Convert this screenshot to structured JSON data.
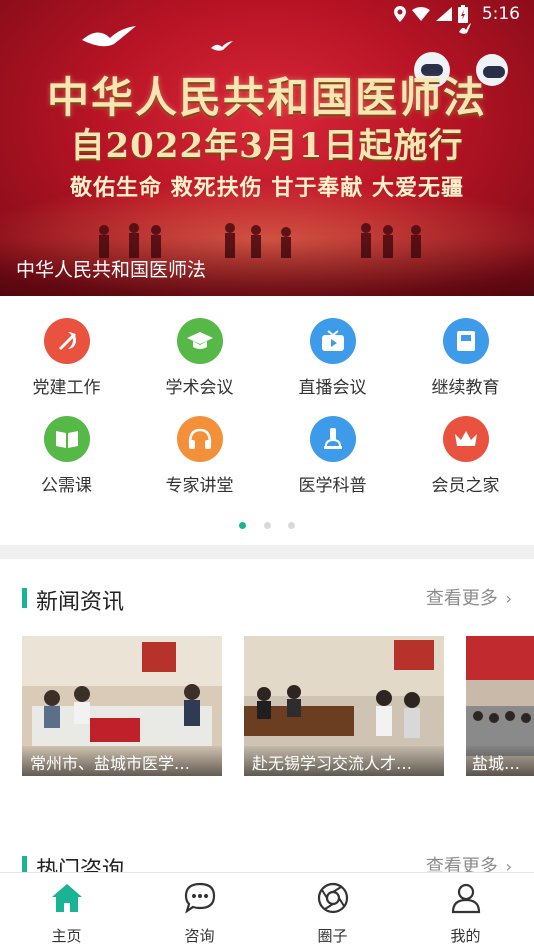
{
  "status_bar": {
    "time": "5:16"
  },
  "banner": {
    "title": "中华人民共和国医师法",
    "subtitle": "自2022年3月1日起施行",
    "slogan": "敬佑生命 救死扶伤 甘于奉献 大爱无疆",
    "caption": "中华人民共和国医师法"
  },
  "grid": {
    "items": [
      {
        "label": "党建工作",
        "icon": "party-icon",
        "color": "#e8523f"
      },
      {
        "label": "学术会议",
        "icon": "graduation-cap-icon",
        "color": "#56b947"
      },
      {
        "label": "直播会议",
        "icon": "tv-play-icon",
        "color": "#3d9be9"
      },
      {
        "label": "继续教育",
        "icon": "book-icon",
        "color": "#3d9be9"
      },
      {
        "label": "公需课",
        "icon": "open-book-icon",
        "color": "#56b947"
      },
      {
        "label": "专家讲堂",
        "icon": "headphones-icon",
        "color": "#f5903a"
      },
      {
        "label": "医学科普",
        "icon": "microscope-icon",
        "color": "#3d9be9"
      },
      {
        "label": "会员之家",
        "icon": "crown-icon",
        "color": "#e8523f"
      }
    ],
    "page_count": 3,
    "active_page": 1
  },
  "news": {
    "title": "新闻资讯",
    "more": "查看更多",
    "items": [
      {
        "caption": "常州市、盐城市医学…"
      },
      {
        "caption": "赴无锡学习交流人才…"
      },
      {
        "caption": "盐城市医"
      }
    ]
  },
  "consult": {
    "title": "热门咨询",
    "more": "查看更多"
  },
  "bottom_nav": {
    "items": [
      {
        "label": "主页",
        "icon": "home-icon"
      },
      {
        "label": "咨询",
        "icon": "chat-icon"
      },
      {
        "label": "圈子",
        "icon": "circle-icon"
      },
      {
        "label": "我的",
        "icon": "user-icon"
      }
    ],
    "active": 0,
    "active_color": "#1ab394"
  }
}
